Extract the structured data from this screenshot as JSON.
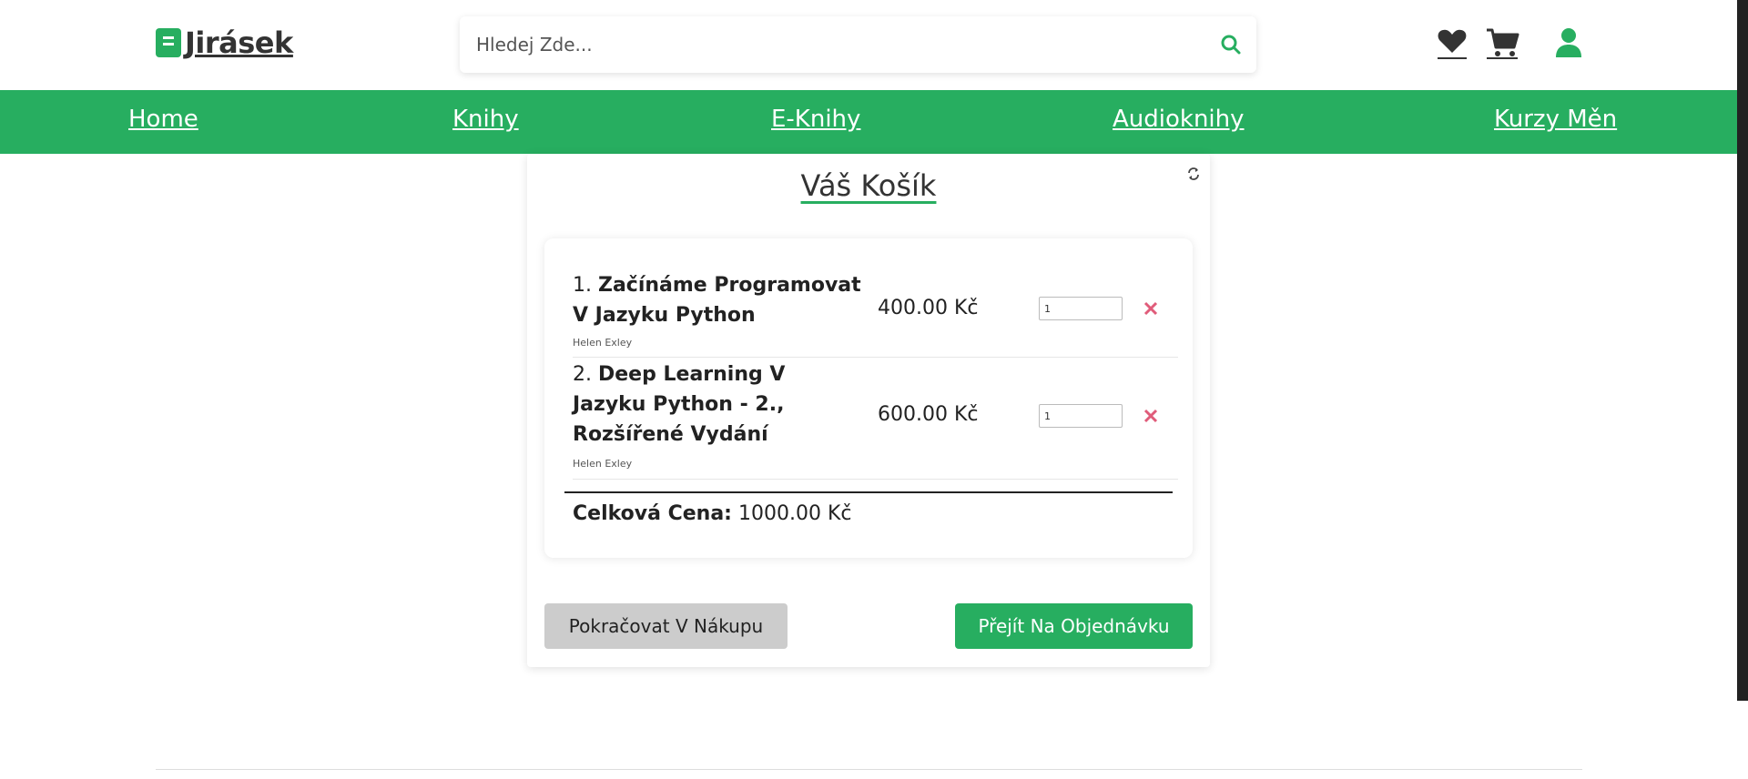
{
  "header": {
    "logo_text": "Jirásek",
    "search_placeholder": "Hledej Zde...",
    "icons": [
      "book-icon",
      "search-icon",
      "heart-icon",
      "cart-icon",
      "user-icon"
    ]
  },
  "nav": {
    "items": [
      "Home",
      "Knihy",
      "E-Knihy",
      "Audioknihy",
      "Kurzy Měn"
    ]
  },
  "cart": {
    "title": "Váš Košík",
    "items": [
      {
        "index": "1.",
        "title": "Začínáme Programovat V Jazyku Python",
        "author": "Helen Exley",
        "price": "400.00 Kč",
        "quantity": "1"
      },
      {
        "index": "2.",
        "title": "Deep Learning V Jazyku Python - 2., Rozšířené Vydání",
        "author": "Helen Exley",
        "price": "600.00 Kč",
        "quantity": "1"
      }
    ],
    "total_label": "Celková Cena:",
    "total_value": "1000.00 Kč",
    "continue_button": "Pokračovat V Nákupu",
    "order_button": "Přejít Na Objednávku"
  },
  "colors": {
    "brand": "#27ae60",
    "remove": "#e05c7a",
    "continue_bg": "#cccccc"
  }
}
